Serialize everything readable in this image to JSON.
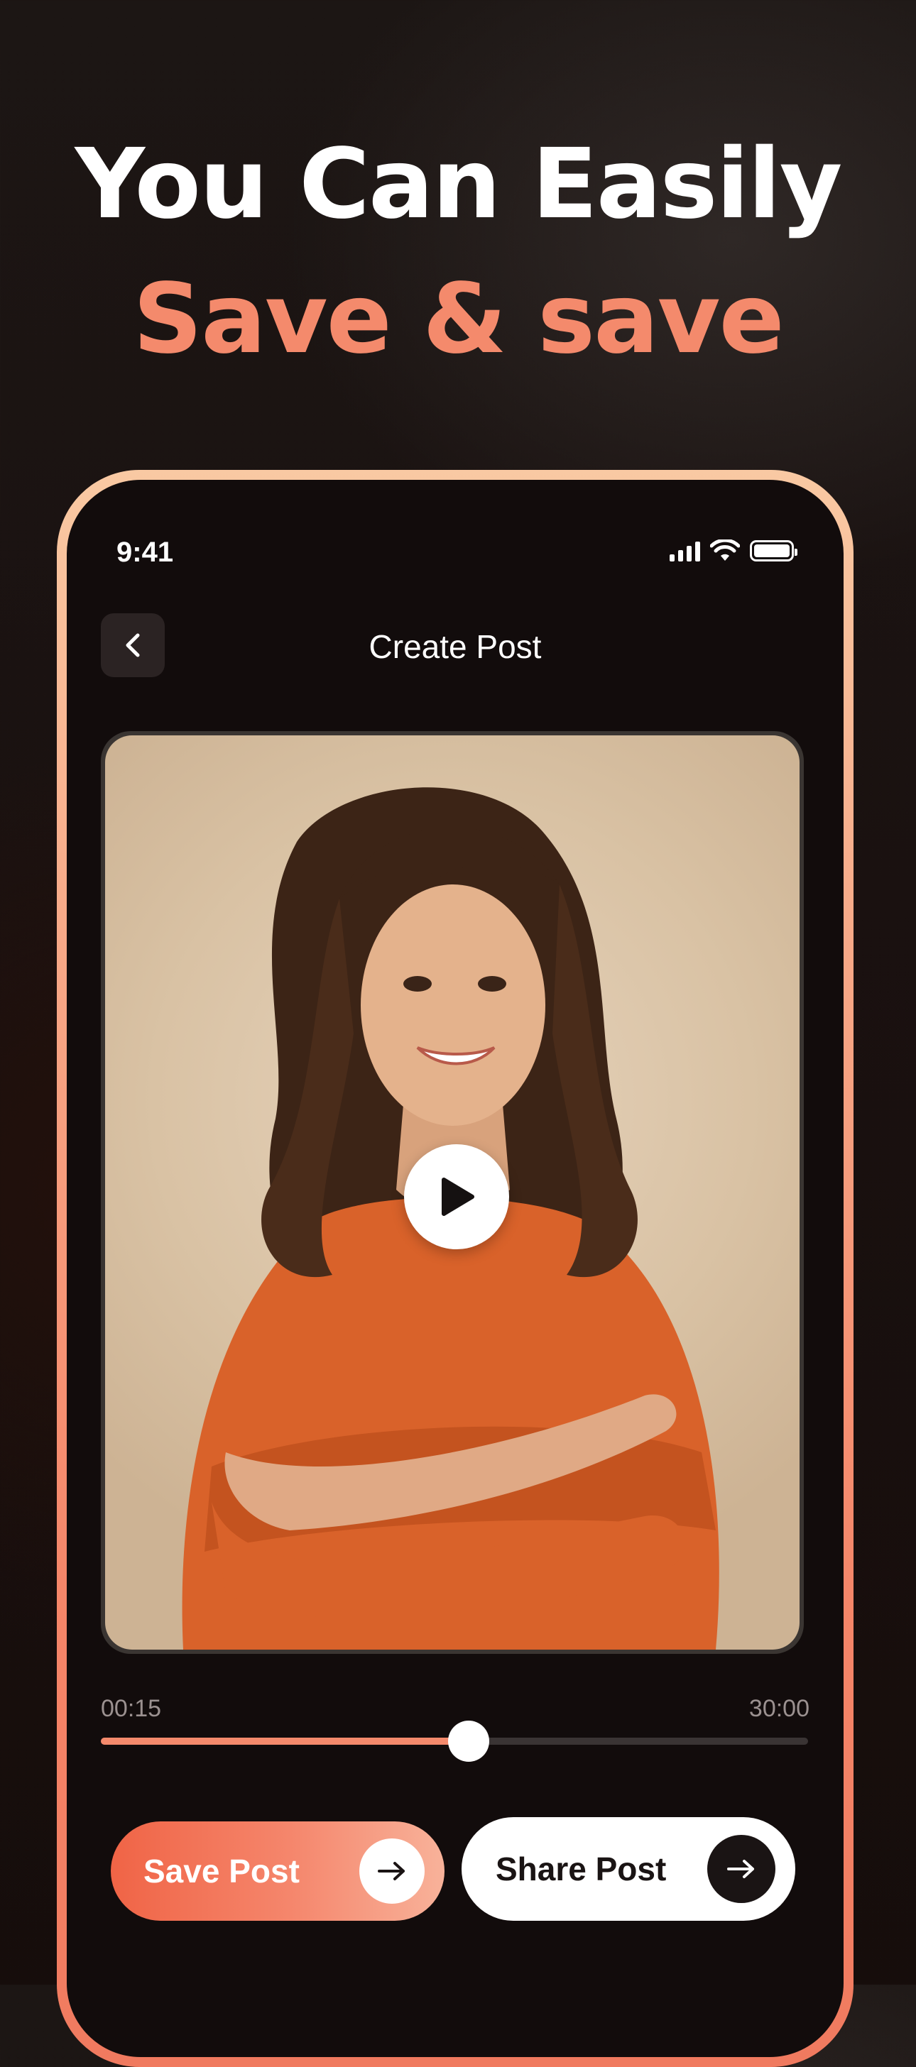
{
  "headline": {
    "line1": "You Can Easily",
    "line2": "Save & save"
  },
  "status_bar": {
    "time": "9:41"
  },
  "header": {
    "title": "Create Post"
  },
  "media": {
    "image_description_icon": "portrait-photo",
    "play_icon": "play-icon"
  },
  "player": {
    "current_time": "00:15",
    "total_time": "30:00",
    "progress": 0.52
  },
  "actions": {
    "save_label": "Save Post",
    "share_label": "Share Post"
  },
  "colors": {
    "accent": "#f48a6c",
    "background": "#140d0c",
    "frame": "#f7a887"
  }
}
